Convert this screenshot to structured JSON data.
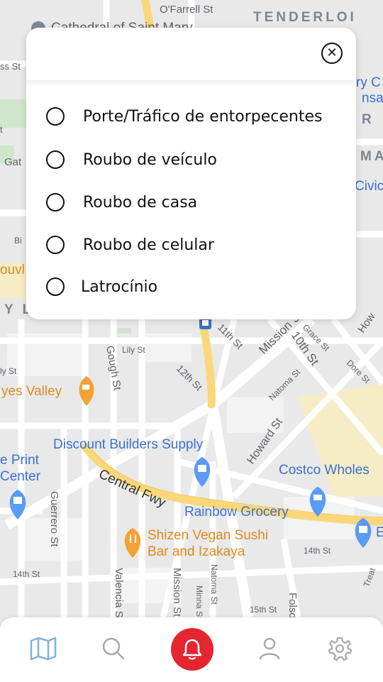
{
  "map": {
    "districts": [
      "TENDERLOI",
      "MA",
      "Y L"
    ],
    "streets": [
      "O'Farrell St",
      "Gough St",
      "Lily St",
      "12th St",
      "11th St",
      "Mission St",
      "10th St",
      "Grace St",
      "Natoma St",
      "Dore St",
      "Howard St",
      "Central Fwy",
      "Guerrero St",
      "Valencia St",
      "Mission St",
      "Minna St",
      "Natoma St",
      "14th St",
      "15th St",
      "14th St",
      "Folsom St",
      "How",
      "Bi",
      "ly St",
      "Treat"
    ],
    "pois": {
      "hayes_valley": "yes Valley",
      "discount_builders": "Discount Builders Supply",
      "print_center_1": "e Print",
      "print_center_2": "Center",
      "costco": "Costco Wholes",
      "rainbow": "Rainbow Grocery",
      "shizen_1": "Shizen Vegan Sushi",
      "shizen_2": "Bar and Izakaya",
      "civic": "Civic",
      "cathedral": "Cathedral of Saint Mary",
      "ry": "ry C",
      "nsa": "nsa",
      "r": "R",
      "ss": "ss St",
      "t": "t",
      "gat": "Gat",
      "ouvl": "ouvl",
      "e_left": "E"
    }
  },
  "modal": {
    "close_icon": "close-icon",
    "options": [
      {
        "label": "Porte/Tráfico de entorpecentes"
      },
      {
        "label": "Roubo de veículo"
      },
      {
        "label": "Roubo de casa"
      },
      {
        "label": "Roubo de celular"
      },
      {
        "label": "Latrocínio"
      }
    ]
  },
  "tabbar": {
    "tabs": [
      "map-icon",
      "search-icon",
      "bell-icon",
      "user-icon",
      "gear-icon"
    ],
    "colors": {
      "active": "#7fb2d9",
      "inactive": "#a9a9a9",
      "alert": "#e5252f"
    }
  }
}
